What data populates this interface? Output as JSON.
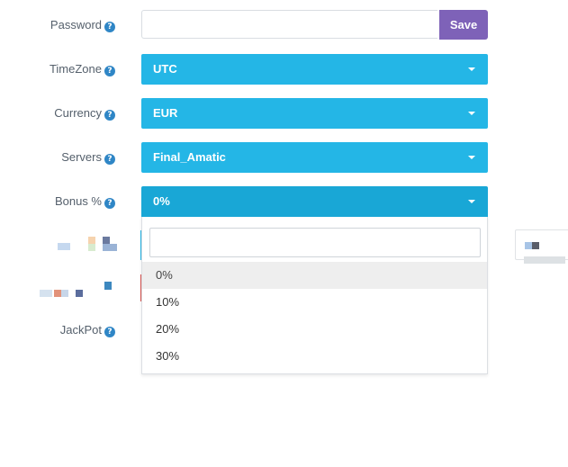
{
  "form": {
    "password": {
      "label": "Password",
      "value": "",
      "save_label": "Save"
    },
    "timezone": {
      "label": "TimeZone",
      "value": "UTC"
    },
    "currency": {
      "label": "Currency",
      "value": "EUR"
    },
    "servers": {
      "label": "Servers",
      "value": "Final_Amatic"
    },
    "bonus": {
      "label": "Bonus %",
      "value": "0%",
      "search_value": "",
      "options": [
        "0%",
        "10%",
        "20%",
        "30%"
      ],
      "selected_index": 0
    },
    "jackpot": {
      "label": "JackPot"
    }
  },
  "icons": {
    "help": "question-circle-icon",
    "caret": "caret-down-icon"
  },
  "colors": {
    "select_bg": "#24b6e6",
    "select_open_bg": "#19a7d6",
    "save_button": "#7e62b8",
    "help_icon": "#2f86c6",
    "option_hover": "#eeeeee"
  }
}
